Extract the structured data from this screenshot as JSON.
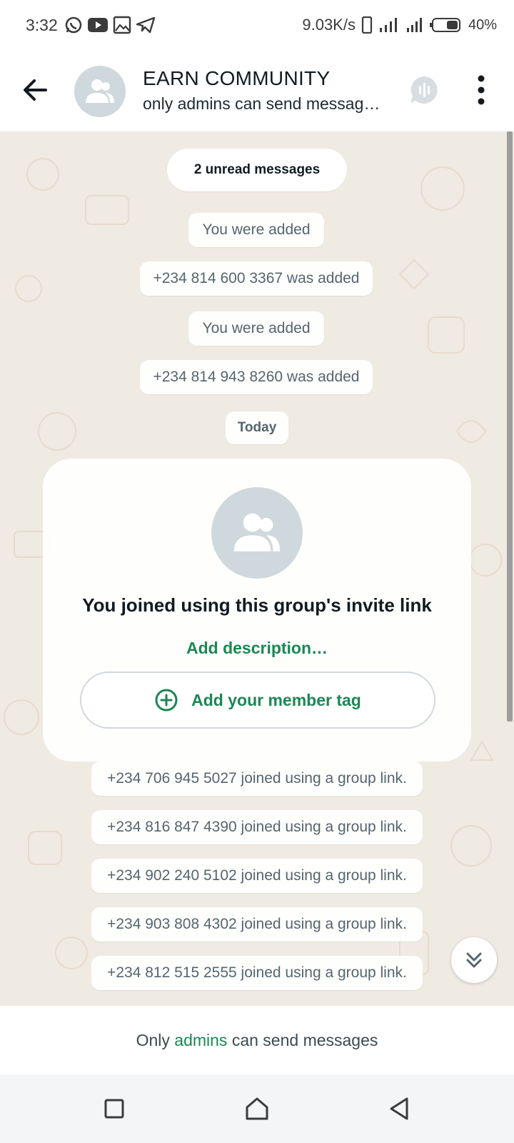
{
  "status_bar": {
    "time": "3:32",
    "network_speed": "9.03K/s",
    "battery": "40%",
    "left_icons": [
      "whatsapp-icon",
      "youtube-icon",
      "gallery-icon",
      "telegram-icon"
    ],
    "right_icons": [
      "vibrate-icon",
      "signal-icon",
      "signal-icon",
      "battery-icon"
    ]
  },
  "header": {
    "title": "EARN COMMUNITY",
    "subtitle": "only admins can send messag…",
    "icons": [
      "back-arrow-icon",
      "group-avatar-icon",
      "voice-chat-icon",
      "more-vert-icon"
    ]
  },
  "chat": {
    "unread_banner": "2 unread messages",
    "system_messages_before": [
      "You were added",
      "+234 814 600 3367 was added",
      "You were added",
      "+234 814 943 8260 was added"
    ],
    "date_chip": "Today",
    "invite_card": {
      "title": "You joined using this group's invite link",
      "add_description": "Add description…",
      "member_tag_button": "Add your member tag"
    },
    "system_messages_after": [
      "+234 706 945 5027 joined using a group link.",
      "+234 816 847 4390 joined using a group link.",
      "+234 902 240 5102 joined using a group link.",
      "+234 903 808 4302 joined using a group link.",
      "+234 812 515 2555 joined using a group link."
    ]
  },
  "footer": {
    "prefix": "Only ",
    "admins_link": "admins",
    "suffix": " can send messages"
  },
  "colors": {
    "accent_green": "#1b8755",
    "chat_background": "#efeae2",
    "avatar_gray": "#cfd8dc"
  },
  "nav_bar": {
    "icons": [
      "recents-square-icon",
      "home-icon",
      "back-triangle-icon"
    ]
  }
}
